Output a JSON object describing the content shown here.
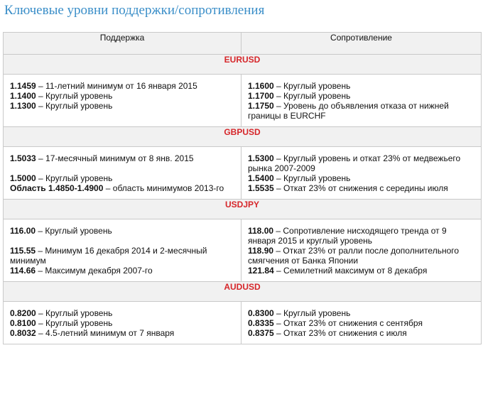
{
  "title": "Ключевые уровни поддержки/сопротивления",
  "headers": {
    "support": "Поддержка",
    "resistance": "Сопротивление"
  },
  "sections": [
    {
      "pair": "EURUSD",
      "rows": [
        {
          "s_level": "1.1459",
          "s_desc": " – 11-летний минимум от 16 января 2015",
          "r_level": "1.1600",
          "r_desc": " – Круглый уровень"
        },
        {
          "s_level": "1.1400",
          "s_desc": " – Круглый уровень",
          "r_level": "1.1700",
          "r_desc": " – Круглый уровень"
        },
        {
          "s_level": "1.1300",
          "s_desc": " – Круглый уровень",
          "r_level": "1.1750",
          "r_desc": " – Уровень до объявления отказа от нижней границы в EURCHF"
        }
      ]
    },
    {
      "pair": "GBPUSD",
      "rows": [
        {
          "s_level": "1.5033",
          "s_desc": " – 17-месячный минимум от 8 янв. 2015",
          "r_level": "1.5300",
          "r_desc": " – Круглый уровень и откат 23% от медвежьего рынка 2007-2009"
        },
        {
          "s_level": "1.5000",
          "s_desc": " – Круглый уровень",
          "r_level": "1.5400",
          "r_desc": " – Круглый уровень"
        },
        {
          "s_level": "Область 1.4850-1.4900",
          "s_desc": " – область минимумов 2013-го",
          "r_level": "1.5535",
          "r_desc": " – Откат 23% от снижения с середины июля"
        }
      ]
    },
    {
      "pair": "USDJPY",
      "rows": [
        {
          "s_level": "116.00",
          "s_desc": " – Круглый уровень",
          "r_level": "118.00",
          "r_desc": " – Сопротивление нисходящего тренда от 9 января 2015 и круглый уровень"
        },
        {
          "s_level": "115.55",
          "s_desc": " – Минимум 16 декабря 2014 и 2-месячный минимум",
          "r_level": "118.90",
          "r_desc": " – Откат 23% от ралли после дополнительного смягчения от Банка Японии"
        },
        {
          "s_level": "114.66",
          "s_desc": " – Максимум декабря 2007-го",
          "r_level": "121.84",
          "r_desc": " – Семилетний максимум от 8 декабря"
        }
      ]
    },
    {
      "pair": "AUDUSD",
      "rows": [
        {
          "s_level": "0.8200",
          "s_desc": " – Круглый уровень",
          "r_level": "0.8300",
          "r_desc": " – Круглый уровень"
        },
        {
          "s_level": "0.8100",
          "s_desc": " – Круглый уровень",
          "r_level": "0.8335",
          "r_desc": " – Откат 23% от снижения с сентября"
        },
        {
          "s_level": "0.8032",
          "s_desc": " – 4.5-летний минимум от 7 января",
          "r_level": "0.8375",
          "r_desc": " – Откат 23% от снижения с июля"
        }
      ]
    }
  ]
}
